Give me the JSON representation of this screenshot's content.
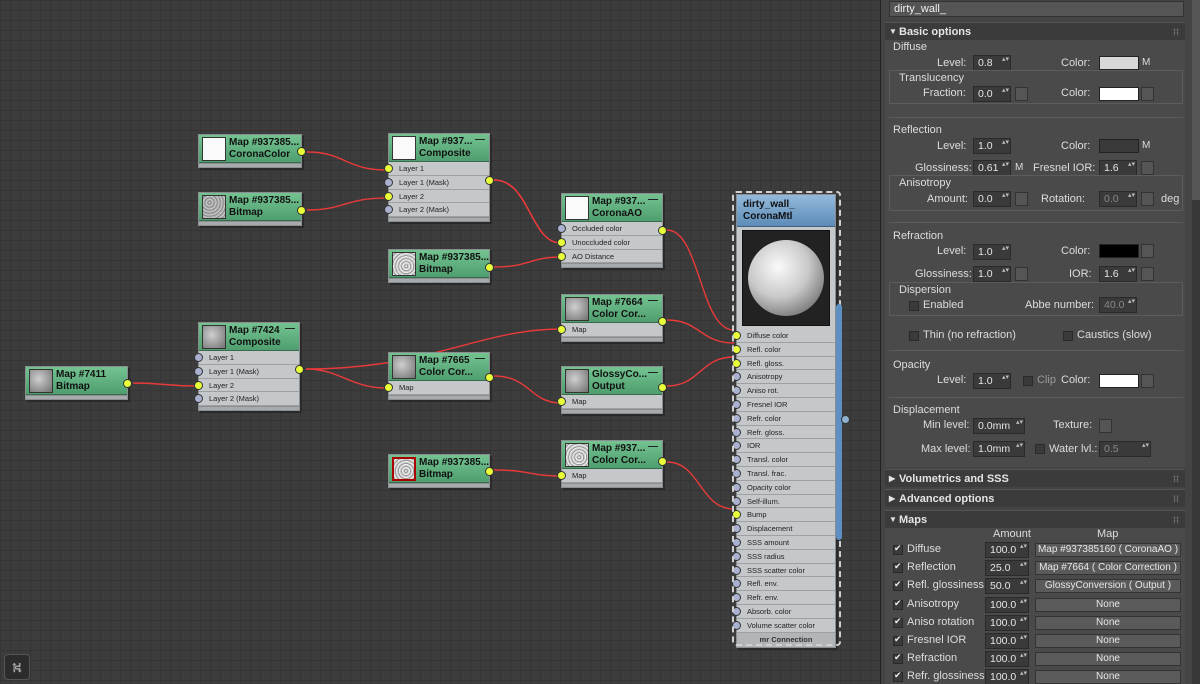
{
  "nodes": {
    "corona_color": {
      "title1": "Map #937385...",
      "title2": "CoronaColor"
    },
    "bitmap_a": {
      "title1": "Map #937385...",
      "title2": "Bitmap"
    },
    "composite_a": {
      "title1": "Map #937...",
      "title2": "Composite",
      "slots": [
        "Layer 1",
        "Layer 1 (Mask)",
        "Layer 2",
        "Layer 2 (Mask)"
      ]
    },
    "corona_ao": {
      "title1": "Map #937...",
      "title2": "CoronaAO",
      "slots": [
        "Occluded color",
        "Unoccluded color",
        "AO Distance"
      ]
    },
    "bitmap_b": {
      "title1": "Map #937385...",
      "title2": "Bitmap"
    },
    "bitmap_7411": {
      "title1": "Map #7411",
      "title2": "Bitmap"
    },
    "composite_7424": {
      "title1": "Map #7424",
      "title2": "Composite",
      "slots": [
        "Layer 1",
        "Layer 1 (Mask)",
        "Layer 2",
        "Layer 2 (Mask)"
      ]
    },
    "cc_7664": {
      "title1": "Map #7664",
      "title2": "Color Cor...",
      "slots": [
        "Map"
      ]
    },
    "cc_7665": {
      "title1": "Map #7665",
      "title2": "Color Cor...",
      "slots": [
        "Map"
      ]
    },
    "glossy": {
      "title1": "GlossyCo...",
      "title2": "Output",
      "slots": [
        "Map"
      ]
    },
    "bitmap_c": {
      "title1": "Map #937385...",
      "title2": "Bitmap"
    },
    "cc_937": {
      "title1": "Map #937...",
      "title2": "Color Cor...",
      "slots": [
        "Map"
      ]
    },
    "material": {
      "title1": "dirty_wall_",
      "title2": "CoronaMtl",
      "slots": [
        "Diffuse color",
        "Refl. color",
        "Refl. gloss.",
        "Anisotropy",
        "Aniso rot.",
        "Fresnel IOR",
        "Refr. color",
        "Refr. gloss.",
        "IOR",
        "Transl. color",
        "Transl. frac.",
        "Opacity color",
        "Self-illum.",
        "Bump",
        "Displacement",
        "SSS amount",
        "SSS radius",
        "SSS scatter color",
        "Refl. env.",
        "Refr. env.",
        "Absorb. color",
        "Volume scatter color"
      ],
      "footer": "mr Connection"
    }
  },
  "panel": {
    "name": "dirty_wall_",
    "basic": {
      "title": "Basic options",
      "diffuse": {
        "header": "Diffuse",
        "level_label": "Level:",
        "level": "0.8",
        "color_label": "Color:",
        "color": "#d8d8d8",
        "m": "M",
        "transl_header": "Translucency",
        "fraction_label": "Fraction:",
        "fraction": "0.0",
        "transl_color_label": "Color:",
        "transl_color": "#ffffff"
      },
      "reflection": {
        "header": "Reflection",
        "level_label": "Level:",
        "level": "1.0",
        "color_label": "Color:",
        "color": "#3a3a3a",
        "m": "M",
        "gloss_label": "Glossiness:",
        "gloss": "0.61",
        "m2": "M",
        "fresnel_label": "Fresnel IOR:",
        "fresnel": "1.6",
        "aniso_header": "Anisotropy",
        "amount_label": "Amount:",
        "amount": "0.0",
        "rotation_label": "Rotation:",
        "rotation": "0.0",
        "deg": "deg"
      },
      "refraction": {
        "header": "Refraction",
        "level_label": "Level:",
        "level": "1.0",
        "color_label": "Color:",
        "color": "#000000",
        "gloss_label": "Glossiness:",
        "gloss": "1.0",
        "ior_label": "IOR:",
        "ior": "1.6",
        "disp_header": "Dispersion",
        "enabled": "Enabled",
        "abbe_label": "Abbe number:",
        "abbe": "40.0",
        "thin": "Thin (no refraction)",
        "caustics": "Caustics (slow)"
      },
      "opacity": {
        "header": "Opacity",
        "level_label": "Level:",
        "level": "1.0",
        "clip": "Clip",
        "color_label": "Color:",
        "color": "#ffffff"
      },
      "displacement": {
        "header": "Displacement",
        "min_label": "Min level:",
        "min": "0.0mm",
        "texture_label": "Texture:",
        "max_label": "Max level:",
        "max": "1.0mm",
        "water_label": "Water lvl.:",
        "water": "0.5"
      }
    },
    "volumetrics": {
      "title": "Volumetrics and SSS"
    },
    "advanced": {
      "title": "Advanced options"
    },
    "maps": {
      "title": "Maps",
      "col_amount": "Amount",
      "col_map": "Map",
      "rows": [
        {
          "name": "Diffuse",
          "amount": "100.0",
          "map": "Map #937385160  ( CoronaAO )"
        },
        {
          "name": "Reflection",
          "amount": "25.0",
          "map": "Map #7664  ( Color Correction )"
        },
        {
          "name": "Refl. glossiness",
          "amount": "50.0",
          "map": "GlossyConversion  ( Output )"
        },
        {
          "name": "Anisotropy",
          "amount": "100.0",
          "map": "None"
        },
        {
          "name": "Aniso rotation",
          "amount": "100.0",
          "map": "None"
        },
        {
          "name": "Fresnel IOR",
          "amount": "100.0",
          "map": "None"
        },
        {
          "name": "Refraction",
          "amount": "100.0",
          "map": "None"
        },
        {
          "name": "Refr. glossiness",
          "amount": "100.0",
          "map": "None"
        }
      ]
    }
  }
}
